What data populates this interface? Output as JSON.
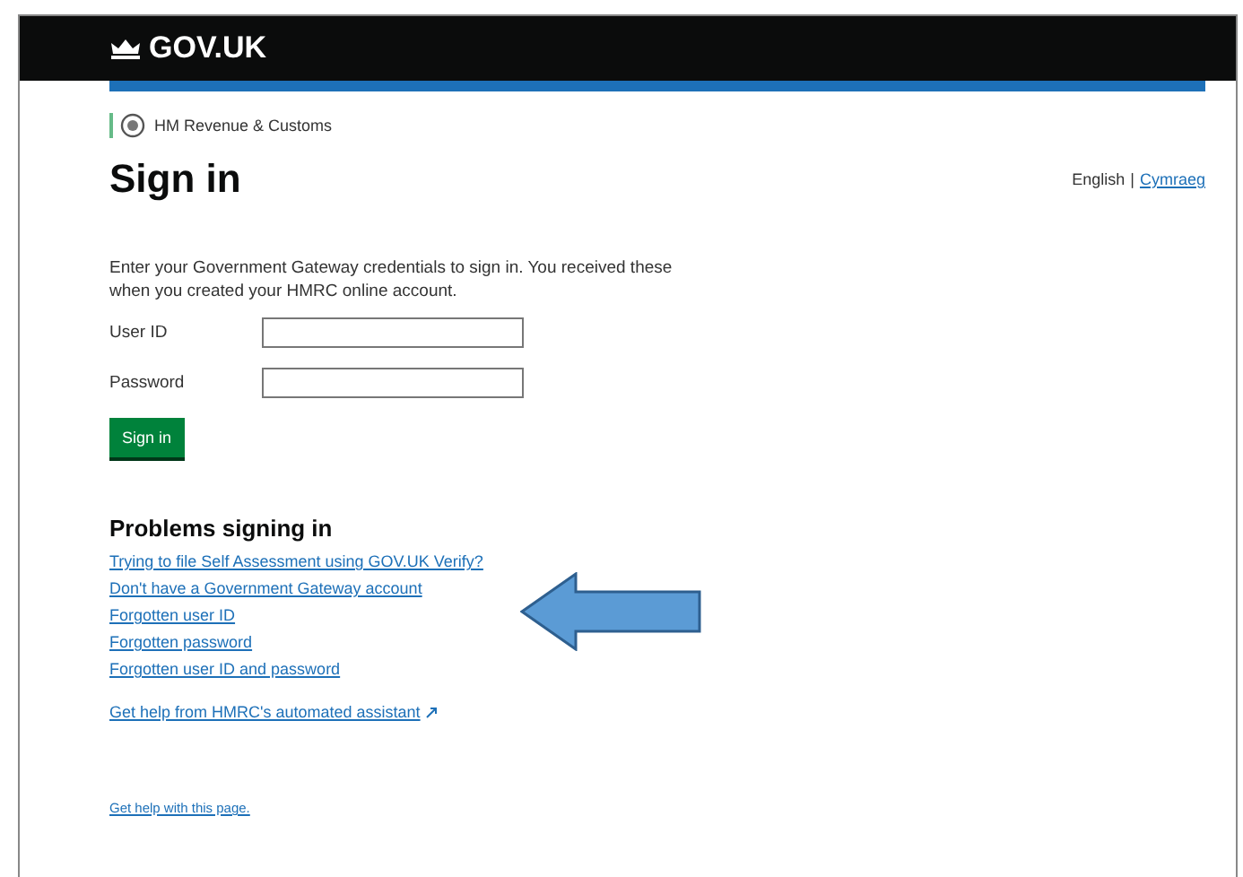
{
  "header": {
    "logo": "GOV.UK"
  },
  "department": "HM Revenue & Customs",
  "title": "Sign in",
  "languages": [
    {
      "label": "English",
      "selected": true
    },
    {
      "label": "Cymraeg",
      "selected": false
    }
  ],
  "language_separator": "|",
  "intro": "Enter your Government Gateway credentials to sign in. You received these when you created your HMRC online account.",
  "fields": [
    {
      "label": "User ID"
    },
    {
      "label": "Password"
    }
  ],
  "submit": "Sign in",
  "problems": {
    "heading": "Problems signing in",
    "links": [
      {
        "label": "Trying to file Self Assessment using GOV.UK Verify?",
        "external": false
      },
      {
        "label": "Don't have a Government Gateway account",
        "external": false
      },
      {
        "label": "Forgotten user ID",
        "external": false
      },
      {
        "label": "Forgotten password",
        "external": false
      },
      {
        "label": "Forgotten user ID and password",
        "external": false
      },
      {
        "label": "Get help from HMRC's automated assistant",
        "external": true
      }
    ]
  },
  "footer_link": "Get help with this page."
}
